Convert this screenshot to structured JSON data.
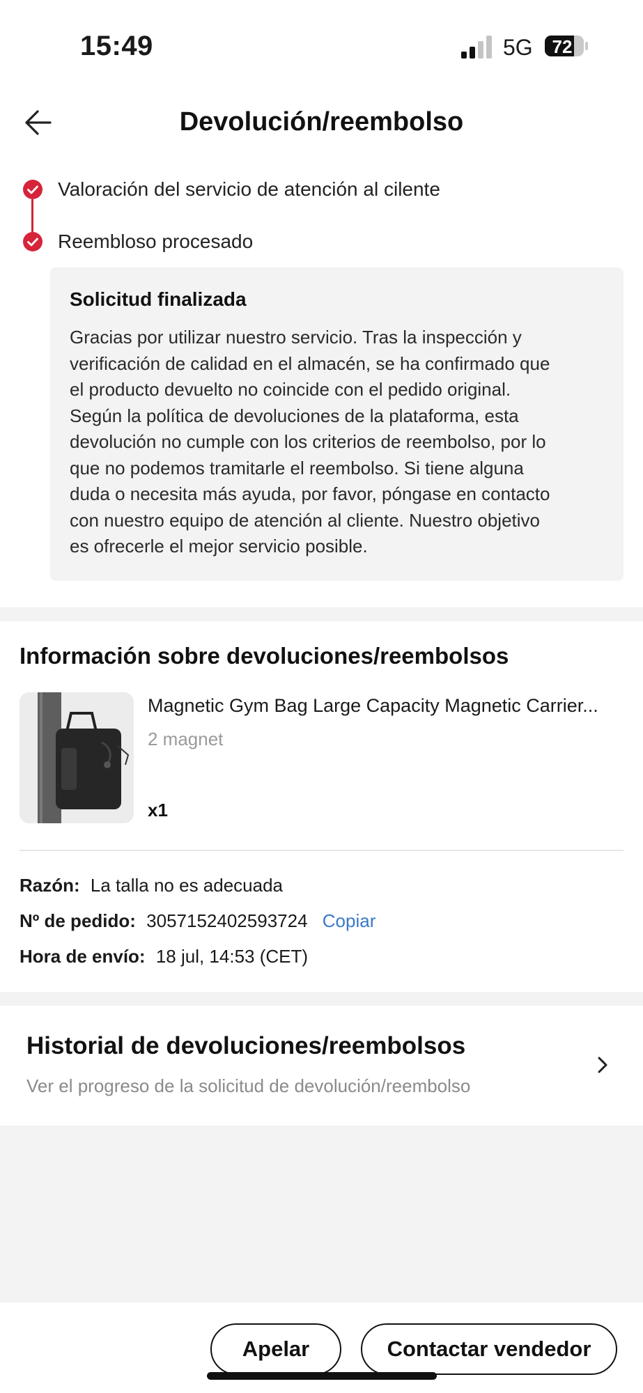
{
  "status_bar": {
    "time": "15:49",
    "network": "5G",
    "battery": "72"
  },
  "header": {
    "title": "Devolución/reembolso",
    "back_icon": "arrow-left-icon"
  },
  "timeline": {
    "accent_color": "#d6243a",
    "steps": [
      {
        "label": "Valoración del servicio de atención al cilente",
        "icon": "check-circle-icon"
      },
      {
        "label": "Reembloso procesado",
        "icon": "check-circle-icon"
      }
    ]
  },
  "notice": {
    "title": "Solicitud finalizada",
    "lines": [
      "Gracias por utilizar nuestro servicio. Tras la inspección y",
      "verificación de calidad en el almacén, se ha confirmado que",
      "el producto devuelto no coincide con el pedido original.",
      "Según la política de devoluciones de la plataforma, esta",
      "devolución no cumple con los criterios de reembolso, por lo",
      "que no podemos tramitarle el reembolso. Si tiene alguna",
      "duda o necesita más ayuda, por favor, póngase en contacto",
      "con nuestro equipo de atención al cliente. Nuestro objetivo",
      "es ofrecerle el mejor servicio posible."
    ]
  },
  "return_info": {
    "title": "Información sobre devoluciones/reembolsos",
    "product": {
      "name": "Magnetic Gym Bag Large Capacity Magnetic Carrier...",
      "variant": "2 magnet",
      "quantity": "x1"
    },
    "reason_label": "Razón:",
    "reason_value": "La talla no es adecuada",
    "order_label": "Nº de pedido:",
    "order_value": "3057152402593724",
    "copy_label": "Copiar",
    "shipping_label": "Hora de envío:",
    "shipping_value": "18 jul, 14:53 (CET)",
    "link_color": "#3a78c9"
  },
  "history": {
    "title": "Historial de devoluciones/reembolsos",
    "subtitle": "Ver el progreso de la solicitud de devolución/reembolso",
    "chevron_icon": "chevron-right-icon"
  },
  "actions": {
    "appeal_label": "Apelar",
    "contact_label": "Contactar vendedor"
  }
}
